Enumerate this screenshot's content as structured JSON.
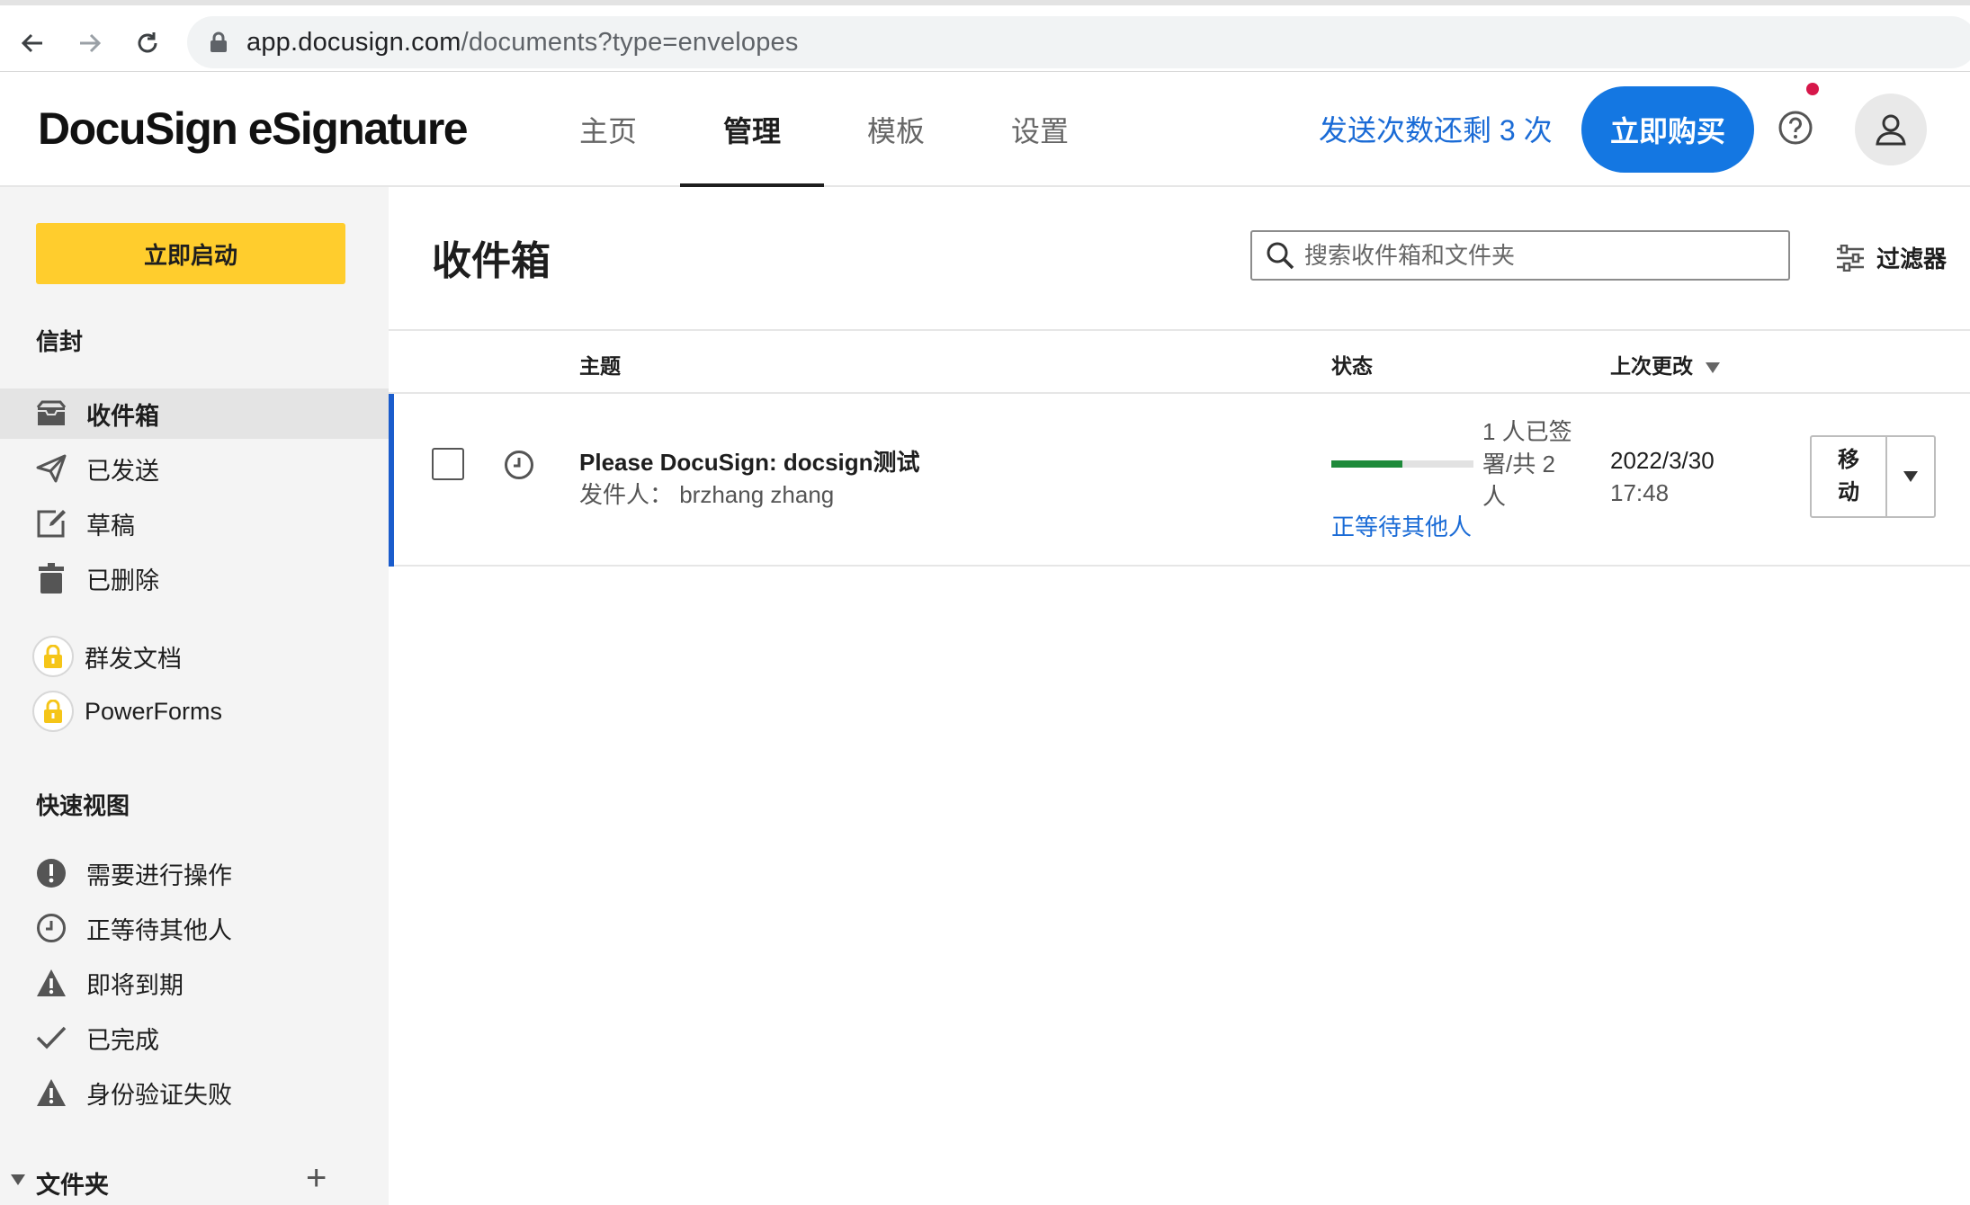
{
  "browser": {
    "url_host": "app.docusign.com",
    "url_path": "/documents?type=envelopes"
  },
  "header": {
    "logo": "DocuSign eSignature",
    "tabs": [
      {
        "label": "主页",
        "active": false
      },
      {
        "label": "管理",
        "active": true
      },
      {
        "label": "模板",
        "active": false
      },
      {
        "label": "设置",
        "active": false
      }
    ],
    "sends_left": "发送次数还剩 3 次",
    "buy_label": "立即购买"
  },
  "sidebar": {
    "start_label": "立即启动",
    "envelopes_heading": "信封",
    "envelopes": [
      {
        "label": "收件箱",
        "icon": "inbox-icon",
        "active": true
      },
      {
        "label": "已发送",
        "icon": "send-icon",
        "active": false
      },
      {
        "label": "草稿",
        "icon": "draft-icon",
        "active": false
      },
      {
        "label": "已删除",
        "icon": "trash-icon",
        "active": false
      }
    ],
    "locked": [
      {
        "label": "群发文档",
        "icon": "lock-icon"
      },
      {
        "label": "PowerForms",
        "icon": "lock-icon"
      }
    ],
    "quick_heading": "快速视图",
    "quick_views": [
      {
        "label": "需要进行操作",
        "icon": "alert-circle-icon"
      },
      {
        "label": "正等待其他人",
        "icon": "clock-icon"
      },
      {
        "label": "即将到期",
        "icon": "warning-icon"
      },
      {
        "label": "已完成",
        "icon": "check-icon"
      },
      {
        "label": "身份验证失败",
        "icon": "warning-icon"
      }
    ],
    "folders_label": "文件夹"
  },
  "main": {
    "title": "收件箱",
    "search_placeholder": "搜索收件箱和文件夹",
    "filter_label": "过滤器",
    "columns": {
      "subject": "主题",
      "status": "状态",
      "last_changed": "上次更改"
    },
    "rows": [
      {
        "subject": "Please DocuSign: docsign测试",
        "sender": "发件人： brzhang zhang",
        "signed_text": "1 人已签署/共 2 人",
        "signed": 1,
        "total": 2,
        "status": "正等待其他人",
        "date": "2022/3/30",
        "time": "17:48",
        "action": "移动"
      }
    ]
  },
  "colors": {
    "accent": "#1477e2",
    "start": "#ffcd2d",
    "progress": "#1e8a3a",
    "link": "#1a6bd6"
  }
}
